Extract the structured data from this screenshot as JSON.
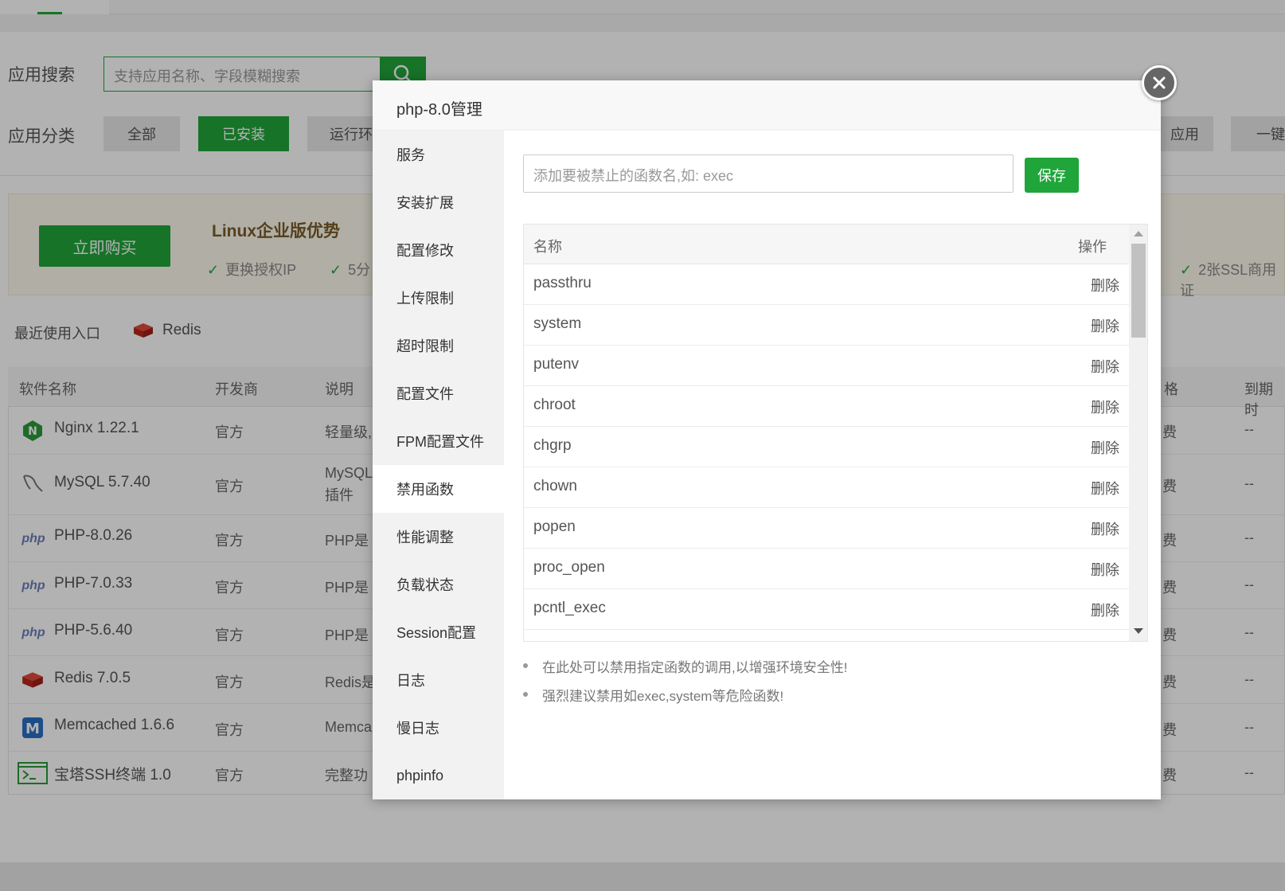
{
  "background": {
    "search": {
      "label": "应用搜索",
      "placeholder": "支持应用名称、字段模糊搜索"
    },
    "categories": {
      "label": "应用分类",
      "items": [
        "全部",
        "已安装",
        "运行环",
        "应用",
        "一键"
      ]
    },
    "promo": {
      "buy_label": "立即购买",
      "title": "Linux企业版优势",
      "features": [
        "更换授权IP",
        "5分",
        "2张SSL商用证"
      ]
    },
    "recent": {
      "label": "最近使用入口",
      "item": "Redis"
    },
    "table": {
      "headers": [
        "软件名称",
        "开发商",
        "说明",
        "格",
        "到期时"
      ],
      "rows": [
        {
          "name": "Nginx 1.22.1",
          "dev": "官方",
          "desc": "轻量级,",
          "price": "费",
          "expire": "--"
        },
        {
          "name": "MySQL 5.7.40",
          "dev": "官方",
          "desc": "MySQL",
          "desc2": "插件",
          "price": "费",
          "expire": "--"
        },
        {
          "name": "PHP-8.0.26",
          "dev": "官方",
          "desc": "PHP是",
          "price": "费",
          "expire": "--"
        },
        {
          "name": "PHP-7.0.33",
          "dev": "官方",
          "desc": "PHP是",
          "price": "费",
          "expire": "--"
        },
        {
          "name": "PHP-5.6.40",
          "dev": "官方",
          "desc": "PHP是",
          "price": "费",
          "expire": "--"
        },
        {
          "name": "Redis 7.0.5",
          "dev": "官方",
          "desc": "Redis是",
          "price": "费",
          "expire": "--"
        },
        {
          "name": "Memcached 1.6.6",
          "dev": "官方",
          "desc": "Memca",
          "price": "费",
          "expire": "--"
        },
        {
          "name": "宝塔SSH终端 1.0",
          "dev": "官方",
          "desc": "完整功",
          "price": "费",
          "expire": "--"
        }
      ]
    }
  },
  "modal": {
    "title": "php-8.0管理",
    "nav": [
      "服务",
      "安装扩展",
      "配置修改",
      "上传限制",
      "超时限制",
      "配置文件",
      "FPM配置文件",
      "禁用函数",
      "性能调整",
      "负载状态",
      "Session配置",
      "日志",
      "慢日志",
      "phpinfo"
    ],
    "active_nav": "禁用函数",
    "input_placeholder": "添加要被禁止的函数名,如: exec",
    "save_label": "保存",
    "table": {
      "col_name": "名称",
      "col_op": "操作",
      "delete_label": "删除",
      "functions": [
        "passthru",
        "system",
        "putenv",
        "chroot",
        "chgrp",
        "chown",
        "popen",
        "proc_open",
        "pcntl_exec"
      ]
    },
    "tips": [
      "在此处可以禁用指定函数的调用,以增强环境安全性!",
      "强烈建议禁用如exec,system等危险函数!"
    ]
  },
  "colors": {
    "brand": "#20a53a"
  }
}
